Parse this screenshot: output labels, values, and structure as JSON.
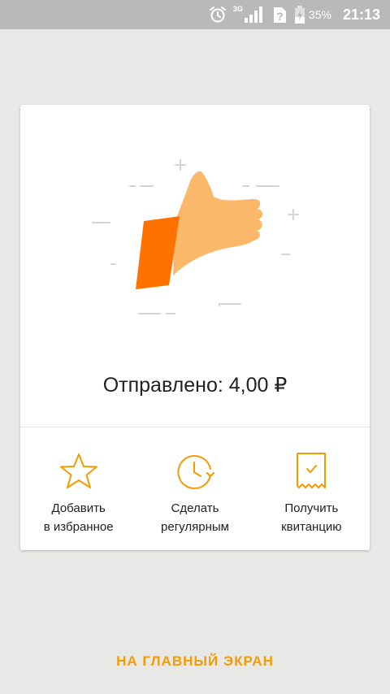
{
  "status_bar": {
    "network": "3G",
    "battery": "35%",
    "time": "21:13",
    "icons": [
      "alarm-icon",
      "signal-icon",
      "no-sim-icon",
      "battery-icon"
    ]
  },
  "result": {
    "sent_text": "Отправлено: 4,00 ₽",
    "illustration": "thumbs-up-icon"
  },
  "actions": [
    {
      "label": "Добавить\nв избранное",
      "icon": "star-icon"
    },
    {
      "label": "Сделать\nрегулярным",
      "icon": "clock-refresh-icon"
    },
    {
      "label": "Получить\nквитанцию",
      "icon": "receipt-icon"
    }
  ],
  "home_button": "НА ГЛАВНЫЙ ЭКРАН",
  "colors": {
    "accent": "#f59b00",
    "cuff": "#ff7200",
    "hand": "#fbb86b",
    "background": "#e8e8e6",
    "status_bar": "#b9b9b7"
  }
}
